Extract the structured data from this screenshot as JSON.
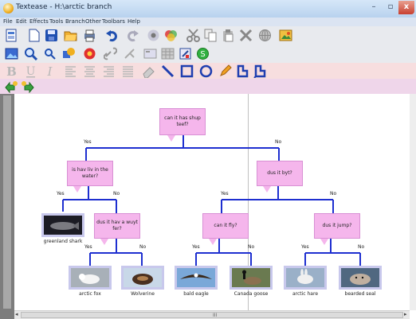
{
  "window": {
    "title": "Textease - H:\\arctic branch",
    "min": "–",
    "max": "▫",
    "close": "x"
  },
  "menu": [
    "File",
    "Edit",
    "Effects",
    "Tools",
    "Branch",
    "Other",
    "Toolbars",
    "Help"
  ],
  "colors": {
    "node": "#f5b6ec",
    "edge": "#1e2fd0",
    "leaf_bg": "#c8c8ec",
    "toolbar3": "#f7dedf",
    "toolbar4": "#efd6ea"
  },
  "questions": {
    "q1": "can it has shup teef?",
    "q2": "is hav liv in the water?",
    "q3": "dus it byt?",
    "q4": "dus it hav a wuyt fer?",
    "q5": "can it fly?",
    "q6": "dus it jump?"
  },
  "edge_labels": {
    "yes": "Yes",
    "no": "No"
  },
  "leaves": {
    "greenland_shark": "greenland shark",
    "arctic_fox": "arctic fox",
    "wolverine": "Wolverine",
    "bald_eagle": "bald eagle",
    "canada_goose": "Canada goose",
    "arctic_hare": "arctic hare",
    "bearded_seal": "bearded seal"
  },
  "toolbar_icons": {
    "row1": [
      "new-page-icon",
      "blank-page-icon",
      "save-icon",
      "open-folder-icon",
      "print-icon",
      "undo-icon",
      "redo-icon",
      "lock-icon",
      "paint-icon",
      "cut-icon",
      "copy-icon",
      "paste-icon",
      "delete-icon",
      "web-icon",
      "picture-icon"
    ],
    "row2": [
      "image-icon",
      "zoom-in-icon",
      "zoom-out-icon",
      "shapes-icon",
      "record-icon",
      "link-icon",
      "branch-icon",
      "slides-icon",
      "table-icon",
      "sound-icon",
      "green-circle-icon"
    ],
    "row3": [
      "bold-icon",
      "underline-icon",
      "italic-icon",
      "align-left-icon",
      "align-center-icon",
      "align-right-icon",
      "justify-icon",
      "eraser-icon",
      "line-icon",
      "rectangle-icon",
      "ellipse-icon",
      "pencil-icon",
      "polygon-icon",
      "bubble-icon"
    ],
    "row4": [
      "branch-left-icon",
      "branch-right-icon"
    ]
  },
  "scrollbar": {
    "grip": "III",
    "left": "◂",
    "right": "▸"
  }
}
